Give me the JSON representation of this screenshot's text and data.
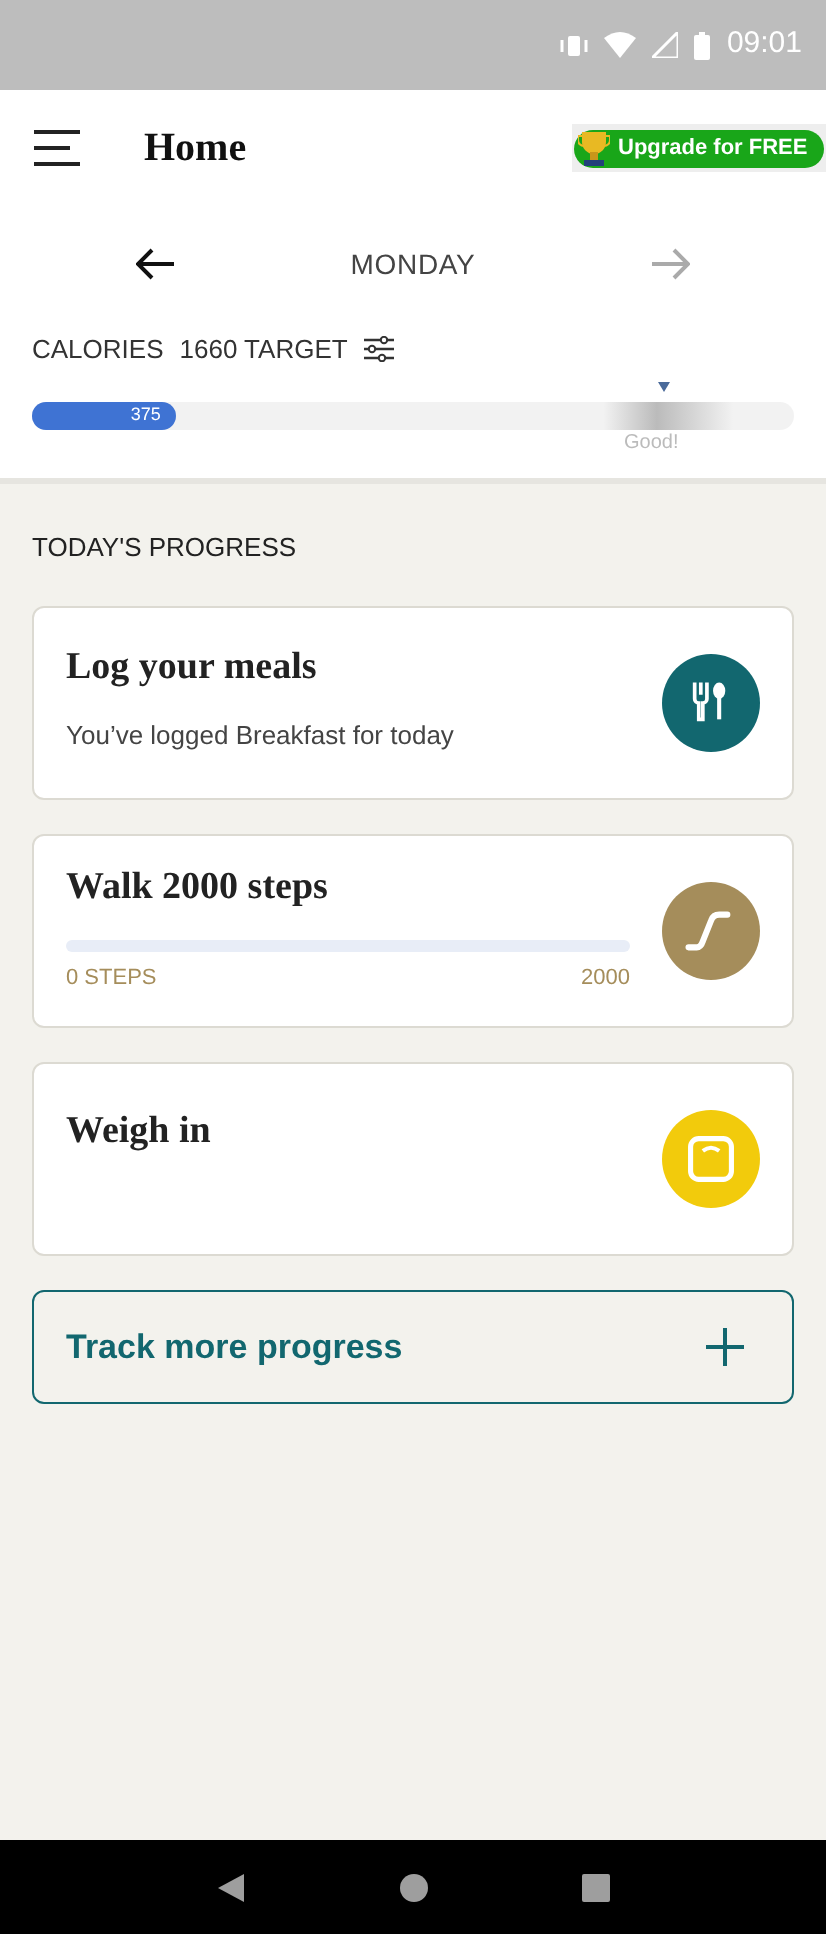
{
  "status_bar": {
    "time": "09:01"
  },
  "header": {
    "title": "Home",
    "upgrade": "Upgrade for FREE"
  },
  "date_nav": {
    "day": "MONDAY",
    "next_disabled": true
  },
  "calories": {
    "label": "CALORIES",
    "target": "1660 TARGET",
    "consumed": "375",
    "level": 0.19,
    "goal_label": "Good!"
  },
  "section_title": "TODAY'S PROGRESS",
  "cards": [
    {
      "kind": "meals",
      "title": "Log your meals",
      "subtitle": "You’ve logged Breakfast for today",
      "color": "#12676f"
    },
    {
      "kind": "steps",
      "title": "Walk 2000 steps",
      "level": 0,
      "start": "0 STEPS",
      "end": "2000",
      "color": "#a58d5b"
    },
    {
      "kind": "weigh",
      "title": "Weigh in",
      "color": "#f2cb0c"
    }
  ],
  "track_more": "Track more progress"
}
